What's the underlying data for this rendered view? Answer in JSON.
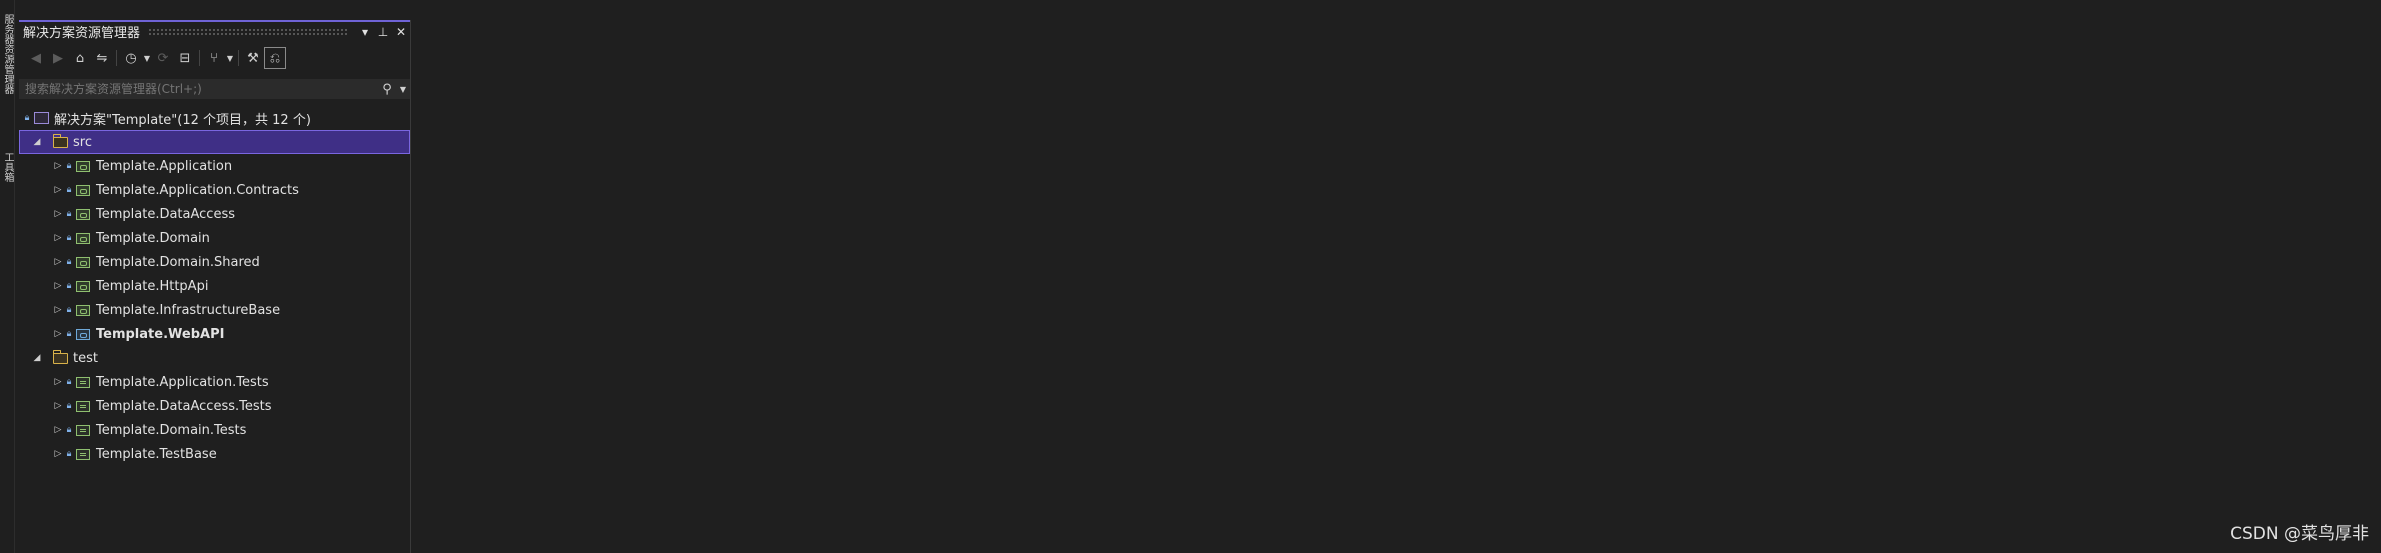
{
  "side_tabs": [
    "服务器资源管理器",
    "工具箱"
  ],
  "panel": {
    "title": "解决方案资源管理器",
    "title_buttons": {
      "dropdown": "▾",
      "pin": "📌",
      "close": "✕"
    },
    "search": {
      "placeholder": "搜索解决方案资源管理器(Ctrl+;)"
    }
  },
  "tree": {
    "solution": "解决方案\"Template\"(12 个项目，共 12 个)",
    "folders": [
      {
        "name": "src",
        "projects": [
          {
            "name": "Template.Application",
            "kind": "lib"
          },
          {
            "name": "Template.Application.Contracts",
            "kind": "lib"
          },
          {
            "name": "Template.DataAccess",
            "kind": "lib"
          },
          {
            "name": "Template.Domain",
            "kind": "lib"
          },
          {
            "name": "Template.Domain.Shared",
            "kind": "lib"
          },
          {
            "name": "Template.HttpApi",
            "kind": "lib"
          },
          {
            "name": "Template.InfrastructureBase",
            "kind": "lib"
          },
          {
            "name": "Template.WebAPI",
            "kind": "web"
          }
        ]
      },
      {
        "name": "test",
        "projects": [
          {
            "name": "Template.Application.Tests",
            "kind": "test"
          },
          {
            "name": "Template.DataAccess.Tests",
            "kind": "test"
          },
          {
            "name": "Template.Domain.Tests",
            "kind": "test"
          },
          {
            "name": "Template.TestBase",
            "kind": "test"
          }
        ]
      }
    ]
  },
  "watermark": "CSDN @菜鸟厚非",
  "colors": {
    "accent": "#6f63d6",
    "selection": "#3f2f86",
    "background": "#1f1f1f"
  }
}
